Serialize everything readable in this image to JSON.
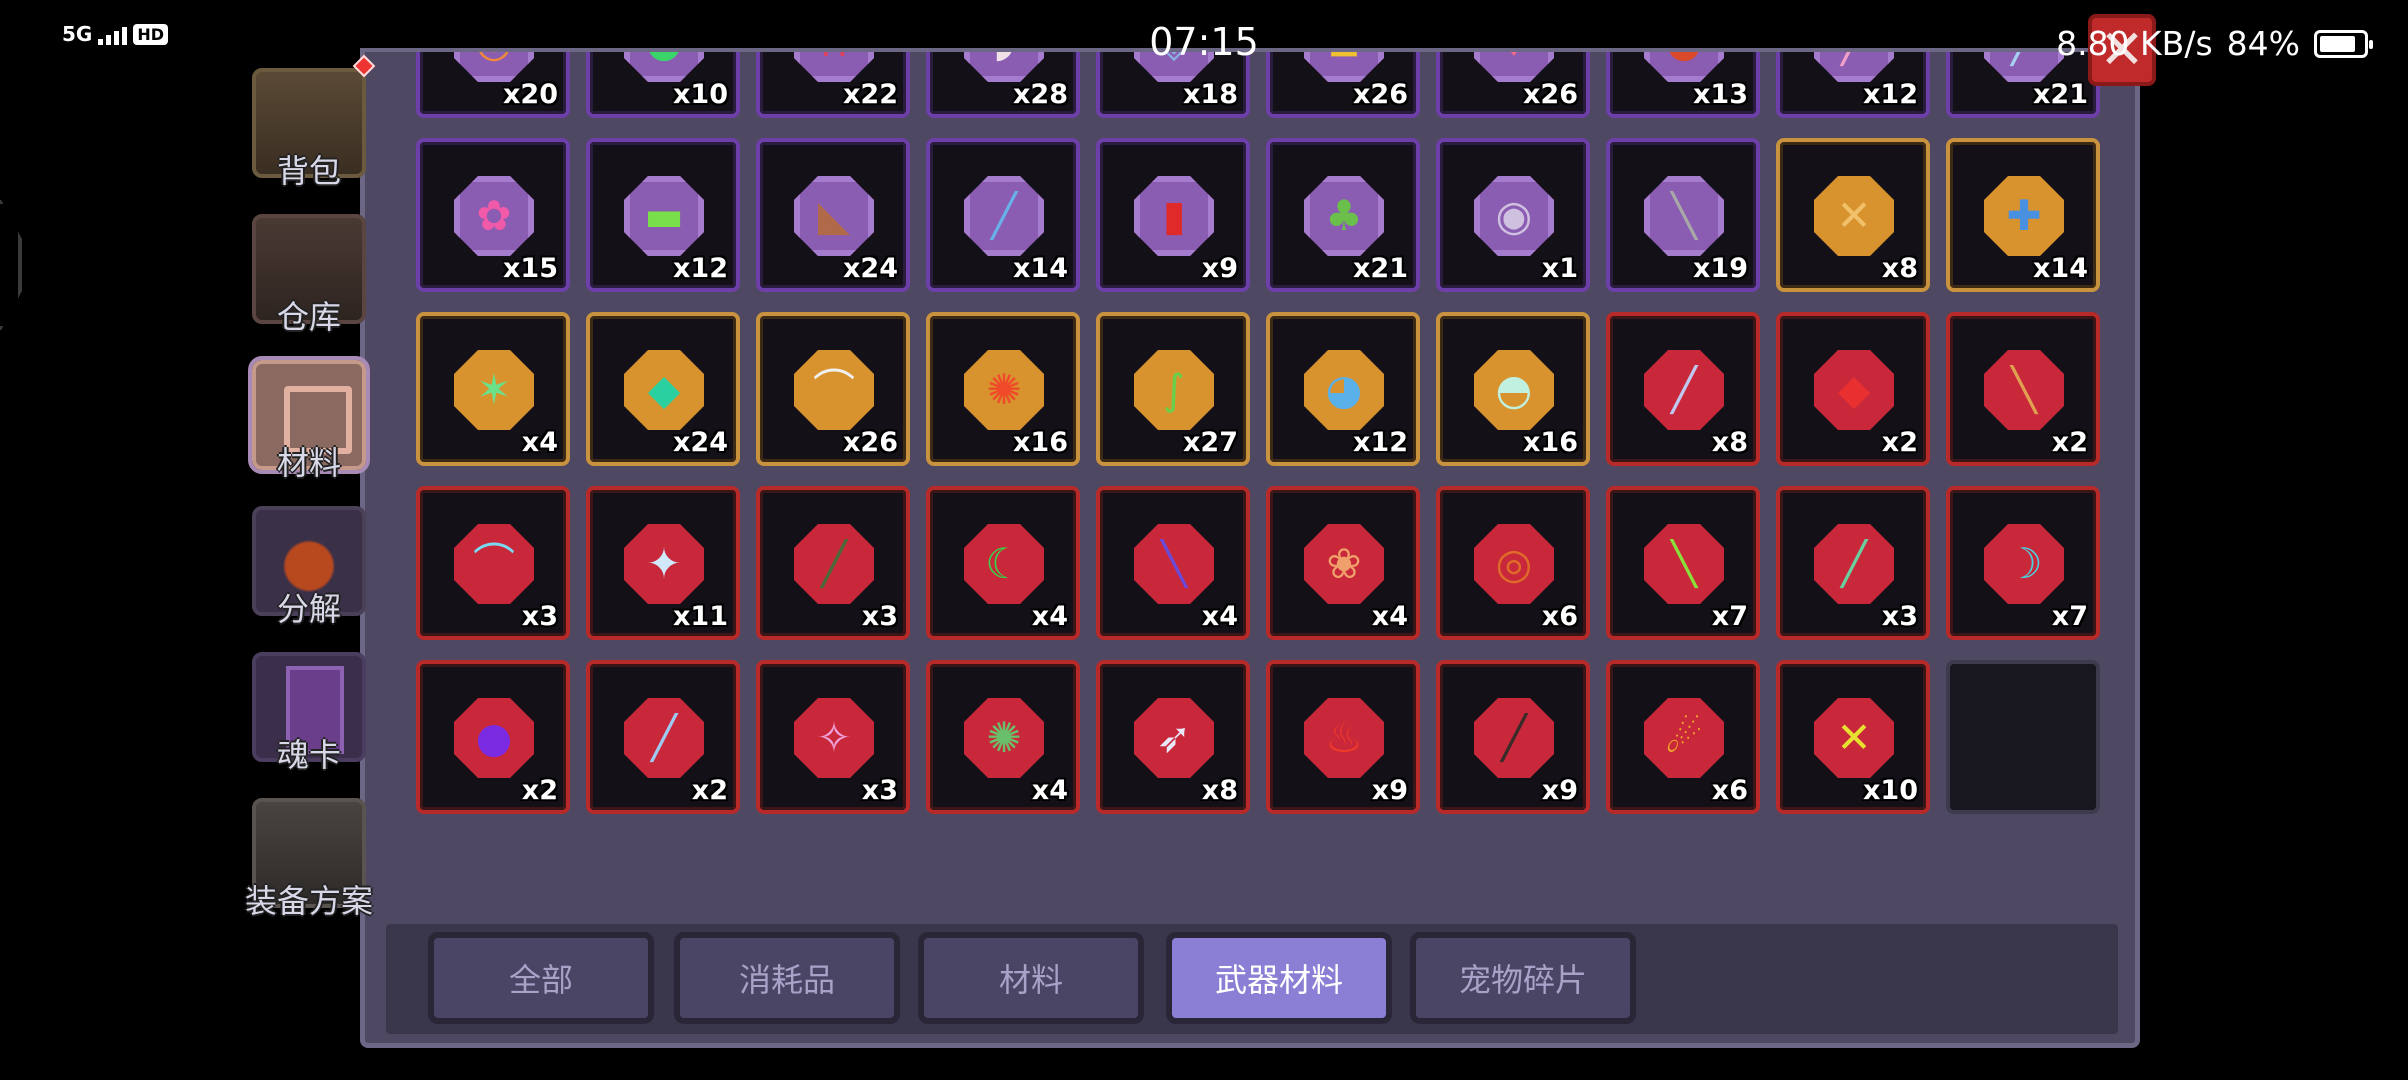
{
  "status_bar": {
    "network": "5G",
    "hd": "HD",
    "time": "07:15",
    "speed": "8.80 KB/s",
    "battery": "84%",
    "battery_level": 0.84
  },
  "sidebar": {
    "items": [
      {
        "label": "背包",
        "art": "bag"
      },
      {
        "label": "仓库",
        "art": "ware"
      },
      {
        "label": "材料",
        "art": "mat",
        "active": true
      },
      {
        "label": "分解",
        "art": "dec"
      },
      {
        "label": "魂卡",
        "art": "card"
      },
      {
        "label": "装备方案",
        "art": "equip"
      }
    ]
  },
  "close_label": "✕",
  "items": [
    {
      "rarity": "purple",
      "icon": "ring-icon",
      "glyph": "◎",
      "color": "#f08a3a",
      "count": "x20"
    },
    {
      "rarity": "purple",
      "icon": "slime-icon",
      "glyph": "●",
      "color": "#3bd46a",
      "count": "x10"
    },
    {
      "rarity": "purple",
      "icon": "hook-icon",
      "glyph": "∩",
      "color": "#e0405a",
      "count": "x22"
    },
    {
      "rarity": "purple",
      "icon": "horn-icon",
      "glyph": "◗",
      "color": "#f0e0e8",
      "count": "x28"
    },
    {
      "rarity": "purple",
      "icon": "badge-icon",
      "glyph": "◈",
      "color": "#8ab0e0",
      "count": "x18"
    },
    {
      "rarity": "purple",
      "icon": "lantern-icon",
      "glyph": "◘",
      "color": "#f0c030",
      "count": "x26"
    },
    {
      "rarity": "purple",
      "icon": "crystal-icon",
      "glyph": "♦",
      "color": "#f06a8a",
      "count": "x26"
    },
    {
      "rarity": "purple",
      "icon": "orb-icon",
      "glyph": "●",
      "color": "#d84a2a",
      "count": "x13"
    },
    {
      "rarity": "purple",
      "icon": "wand-icon",
      "glyph": "╱",
      "color": "#f0a0c8",
      "count": "x12"
    },
    {
      "rarity": "purple",
      "icon": "dagger-icon",
      "glyph": "╱",
      "color": "#a8d0f0",
      "count": "x21"
    },
    {
      "rarity": "purple",
      "icon": "flower-icon",
      "glyph": "✿",
      "color": "#f05aa8",
      "count": "x15"
    },
    {
      "rarity": "purple",
      "icon": "gun-icon",
      "glyph": "▬",
      "color": "#7ae04a",
      "count": "x12"
    },
    {
      "rarity": "purple",
      "icon": "pistol-icon",
      "glyph": "◣",
      "color": "#b06a4a",
      "count": "x24"
    },
    {
      "rarity": "purple",
      "icon": "rod-icon",
      "glyph": "╱",
      "color": "#6ab0e8",
      "count": "x14"
    },
    {
      "rarity": "purple",
      "icon": "extinguisher-icon",
      "glyph": "▮",
      "color": "#e02a2a",
      "count": "x9"
    },
    {
      "rarity": "purple",
      "icon": "cactus-icon",
      "glyph": "♣",
      "color": "#6ac04a",
      "count": "x21"
    },
    {
      "rarity": "purple",
      "icon": "skull-icon",
      "glyph": "◉",
      "color": "#d0c0e0",
      "count": "x1"
    },
    {
      "rarity": "purple",
      "icon": "club-icon",
      "glyph": "╲",
      "color": "#a8a8a8",
      "count": "x19"
    },
    {
      "rarity": "gold",
      "icon": "crossbow-icon",
      "glyph": "✕",
      "color": "#f0c06a",
      "count": "x8"
    },
    {
      "rarity": "gold",
      "icon": "shield-icon",
      "glyph": "✚",
      "color": "#4a90e0",
      "count": "x14"
    },
    {
      "rarity": "gold",
      "icon": "bow-icon",
      "glyph": "✶",
      "color": "#6ae08a",
      "count": "x4"
    },
    {
      "rarity": "gold",
      "icon": "gem-icon",
      "glyph": "◆",
      "color": "#2ad0a0",
      "count": "x24"
    },
    {
      "rarity": "gold",
      "icon": "pickaxe-icon",
      "glyph": "⌒",
      "color": "#f0f0f0",
      "count": "x26"
    },
    {
      "rarity": "gold",
      "icon": "sunflower-icon",
      "glyph": "✺",
      "color": "#f04a2a",
      "count": "x16"
    },
    {
      "rarity": "gold",
      "icon": "snake-icon",
      "glyph": "∫",
      "color": "#6ad04a",
      "count": "x27"
    },
    {
      "rarity": "gold",
      "icon": "cat-icon",
      "glyph": "◕",
      "color": "#5ab0e8",
      "count": "x12"
    },
    {
      "rarity": "gold",
      "icon": "ghost-icon",
      "glyph": "◓",
      "color": "#c0f0e0",
      "count": "x16"
    },
    {
      "rarity": "red",
      "icon": "sword-icon",
      "glyph": "╱",
      "color": "#c0c8f0",
      "count": "x8"
    },
    {
      "rarity": "red",
      "icon": "demon-icon",
      "glyph": "◆",
      "color": "#e83030",
      "count": "x2"
    },
    {
      "rarity": "red",
      "icon": "spear-icon",
      "glyph": "╲",
      "color": "#e0a050",
      "count": "x2"
    },
    {
      "rarity": "red",
      "icon": "ice-bow-icon",
      "glyph": "⌒",
      "color": "#7ad8f0",
      "count": "x3"
    },
    {
      "rarity": "red",
      "icon": "shuriken-icon",
      "glyph": "✦",
      "color": "#d0e8f8",
      "count": "x11"
    },
    {
      "rarity": "red",
      "icon": "cannon-icon",
      "glyph": "╱",
      "color": "#4a6a3a",
      "count": "x3"
    },
    {
      "rarity": "red",
      "icon": "scythe-icon",
      "glyph": "☾",
      "color": "#3ad04a",
      "count": "x4"
    },
    {
      "rarity": "red",
      "icon": "staff-icon",
      "glyph": "╲",
      "color": "#6a4ad8",
      "count": "x4"
    },
    {
      "rarity": "red",
      "icon": "fox-icon",
      "glyph": "❀",
      "color": "#f0a06a",
      "count": "x4"
    },
    {
      "rarity": "red",
      "icon": "fire-ring-icon",
      "glyph": "◎",
      "color": "#e06a2a",
      "count": "x6"
    },
    {
      "rarity": "red",
      "icon": "green-blade-icon",
      "glyph": "╲",
      "color": "#8ae03a",
      "count": "x7"
    },
    {
      "rarity": "red",
      "icon": "crystal-blade-icon",
      "glyph": "╱",
      "color": "#6ad0a0",
      "count": "x3"
    },
    {
      "rarity": "red",
      "icon": "rainbow-claw-icon",
      "glyph": "☽",
      "color": "#4ad0e0",
      "count": "x7"
    },
    {
      "rarity": "red",
      "icon": "void-orb-icon",
      "glyph": "●",
      "color": "#7a2ae0",
      "count": "x2"
    },
    {
      "rarity": "red",
      "icon": "ice-dagger-icon",
      "glyph": "╱",
      "color": "#a0c8f0",
      "count": "x2"
    },
    {
      "rarity": "red",
      "icon": "bone-bow-icon",
      "glyph": "✧",
      "color": "#f0a0d8",
      "count": "x3"
    },
    {
      "rarity": "red",
      "icon": "mace-icon",
      "glyph": "✺",
      "color": "#6ac06a",
      "count": "x4"
    },
    {
      "rarity": "red",
      "icon": "arrow-icon",
      "glyph": "➶",
      "color": "#e8e8f8",
      "count": "x8"
    },
    {
      "rarity": "red",
      "icon": "flame-icon",
      "glyph": "♨",
      "color": "#f03a2a",
      "count": "x9"
    },
    {
      "rarity": "red",
      "icon": "dark-sword-icon",
      "glyph": "╱",
      "color": "#3a2a2a",
      "count": "x9"
    },
    {
      "rarity": "red",
      "icon": "fireball-icon",
      "glyph": "☄",
      "color": "#f0a02a",
      "count": "x6"
    },
    {
      "rarity": "red",
      "icon": "crossed-swords-icon",
      "glyph": "✕",
      "color": "#e8e030",
      "count": "x10"
    },
    {
      "rarity": "empty",
      "icon": "",
      "glyph": "",
      "color": "",
      "count": ""
    }
  ],
  "tabs": [
    {
      "label": "全部"
    },
    {
      "label": "消耗品"
    },
    {
      "label": "材料"
    },
    {
      "label": "武器材料",
      "active": true
    },
    {
      "label": "宠物碎片"
    }
  ]
}
